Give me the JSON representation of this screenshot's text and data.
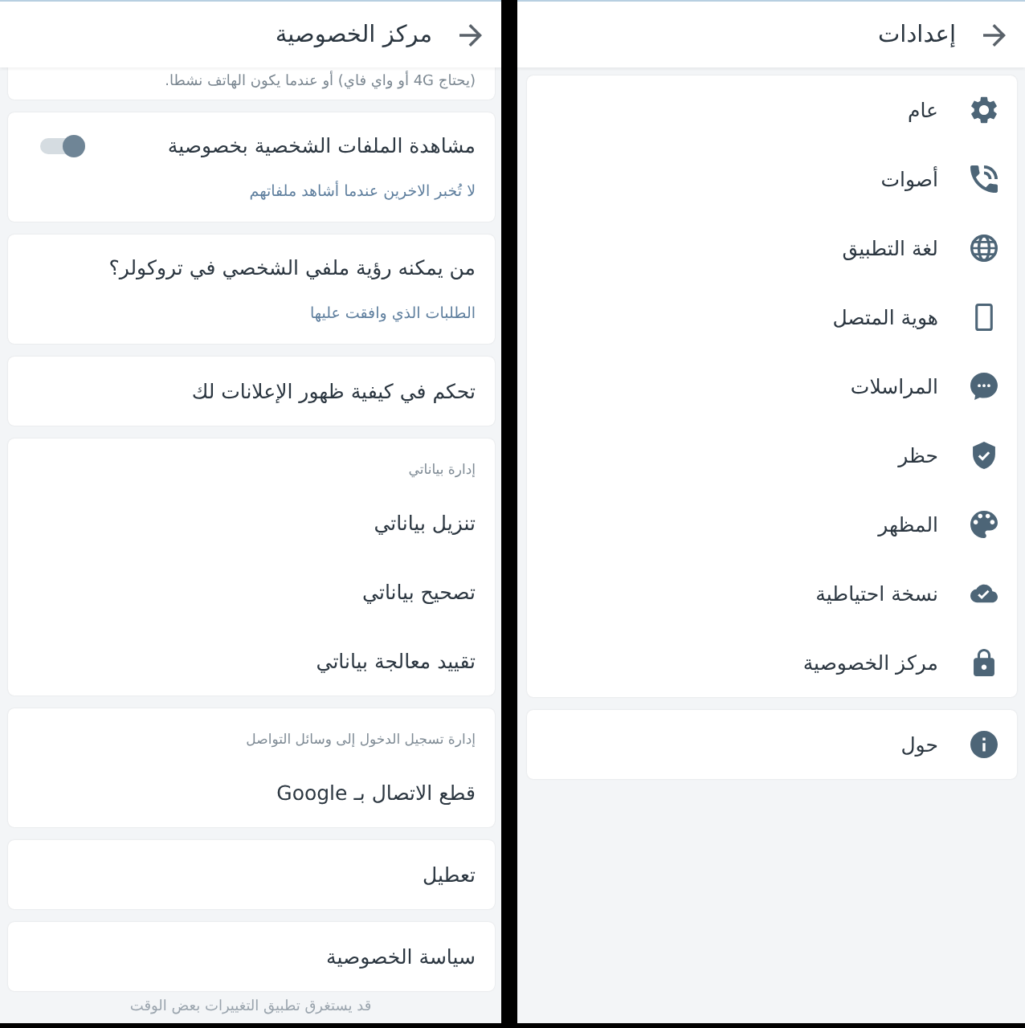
{
  "privacy_center": {
    "title": "مركز الخصوصية",
    "cards": [
      {
        "rows": [
          {
            "kind": "note",
            "text": "(يحتاج 4G أو واي فاي) أو عندما يكون الهاتف نشطا."
          }
        ]
      },
      {
        "rows": [
          {
            "kind": "toggle",
            "title": "مشاهدة الملفات الشخصية بخصوصية",
            "subtitle": "لا تُخبر الاخرين عندما أشاهد ملفاتهم",
            "on": false
          }
        ]
      },
      {
        "rows": [
          {
            "kind": "item",
            "title": "من يمكنه رؤية ملفي الشخصي في تروكولر؟",
            "subtitle": "الطلبات الذي وافقت عليها"
          }
        ]
      },
      {
        "rows": [
          {
            "kind": "item",
            "title": "تحكم في كيفية ظهور الإعلانات لك"
          }
        ]
      },
      {
        "rows": [
          {
            "kind": "section",
            "text": "إدارة بياناتي"
          },
          {
            "kind": "item",
            "title": "تنزيل بياناتي"
          },
          {
            "kind": "item",
            "title": "تصحيح بياناتي"
          },
          {
            "kind": "item",
            "title": "تقييد معالجة بياناتي"
          }
        ]
      },
      {
        "rows": [
          {
            "kind": "section",
            "text": "إدارة تسجيل الدخول إلى وسائل التواصل"
          },
          {
            "kind": "item",
            "title": "قطع الاتصال بـ Google"
          }
        ]
      },
      {
        "rows": [
          {
            "kind": "item",
            "title": "تعطيل"
          }
        ]
      },
      {
        "rows": [
          {
            "kind": "item",
            "title": "سياسة الخصوصية"
          }
        ]
      }
    ],
    "footer": "قد يستغرق تطبيق التغييرات بعض الوقت"
  },
  "settings": {
    "title": "إعدادات",
    "groups": [
      {
        "items": [
          "عام",
          "أصوات",
          "لغة التطبيق",
          "هوية المتصل",
          "المراسلات",
          "حظر",
          "المظهر",
          "نسخة احتياطية",
          "مركز الخصوصية"
        ]
      },
      {
        "items": [
          "حول"
        ]
      }
    ]
  }
}
